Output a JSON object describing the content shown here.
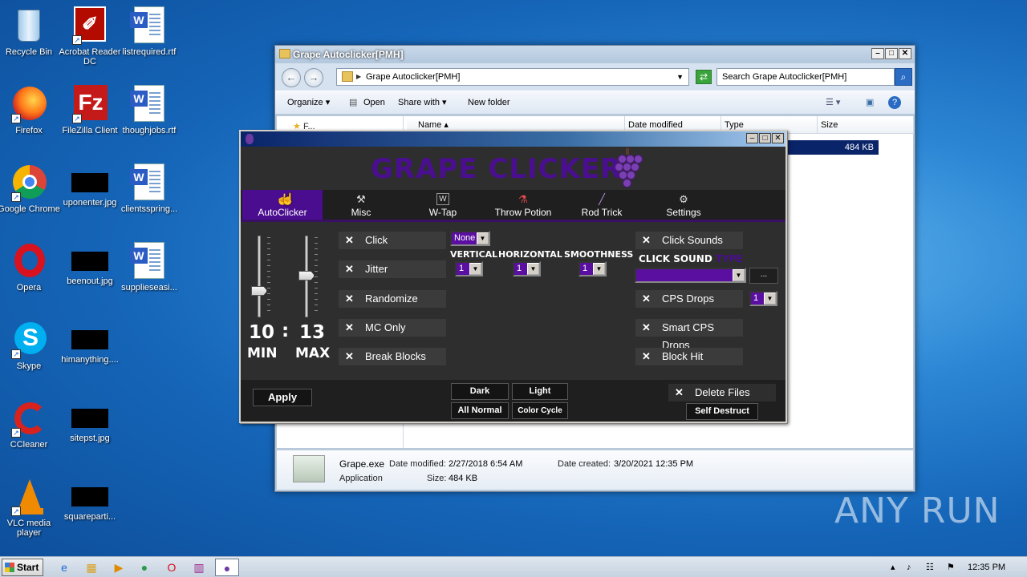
{
  "desktop": {
    "icons": [
      {
        "label": "Recycle Bin",
        "icon": "recycle-bin-icon"
      },
      {
        "label": "Acrobat Reader DC",
        "icon": "acrobat-icon"
      },
      {
        "label": "listrequired.rtf",
        "icon": "word-doc-icon"
      },
      {
        "label": "Firefox",
        "icon": "firefox-icon"
      },
      {
        "label": "FileZilla Client",
        "icon": "filezilla-icon"
      },
      {
        "label": "thoughjobs.rtf",
        "icon": "word-doc-icon"
      },
      {
        "label": "Google Chrome",
        "icon": "chrome-icon"
      },
      {
        "label": "uponenter.jpg",
        "icon": "image-thumb-icon"
      },
      {
        "label": "clientsspring...",
        "icon": "word-doc-icon"
      },
      {
        "label": "Opera",
        "icon": "opera-icon"
      },
      {
        "label": "beenout.jpg",
        "icon": "image-thumb-icon"
      },
      {
        "label": "supplieseasi...",
        "icon": "word-doc-icon"
      },
      {
        "label": "Skype",
        "icon": "skype-icon"
      },
      {
        "label": "himanything....",
        "icon": "image-thumb-icon"
      },
      {
        "label": "CCleaner",
        "icon": "ccleaner-icon"
      },
      {
        "label": "sitepst.jpg",
        "icon": "image-thumb-icon"
      },
      {
        "label": "VLC media player",
        "icon": "vlc-icon"
      },
      {
        "label": "squareparti...",
        "icon": "image-thumb-icon"
      }
    ]
  },
  "explorer": {
    "title": "Grape Autoclicker[PMH]",
    "address": "Grape Autoclicker[PMH]",
    "search_placeholder": "Search Grape Autoclicker[PMH]",
    "toolbar": {
      "organize": "Organize",
      "open": "Open",
      "share_with": "Share with",
      "new_folder": "New folder"
    },
    "columns": {
      "name": "Name",
      "date_modified": "Date modified",
      "type": "Type",
      "size": "Size"
    },
    "selected_size": "484 KB",
    "nav_partial": "F...",
    "details": {
      "filename": "Grape.exe",
      "date_modified_label": "Date modified:",
      "date_modified": "2/27/2018 6:54 AM",
      "date_created_label": "Date created:",
      "date_created": "3/20/2021 12:35 PM",
      "type": "Application",
      "size_label": "Size:",
      "size": "484 KB"
    }
  },
  "grape": {
    "logo": "GRAPE CLICKER",
    "tabs": [
      {
        "label": "AutoClicker",
        "icon": "cursor-icon"
      },
      {
        "label": "Misc",
        "icon": "wrench-icon"
      },
      {
        "label": "W-Tap",
        "icon": "w-key-icon"
      },
      {
        "label": "Throw Potion",
        "icon": "potion-icon"
      },
      {
        "label": "Rod Trick",
        "icon": "fishing-rod-icon"
      },
      {
        "label": "Settings",
        "icon": "gear-icon"
      }
    ],
    "cps": {
      "min": "10",
      "separator": ":",
      "max": "13",
      "min_label": "MIN",
      "max_label": "MAX"
    },
    "left_options": [
      "Click",
      "Jitter",
      "Randomize",
      "MC Only",
      "Break Blocks"
    ],
    "option_mark": "✕",
    "mode_select": "None",
    "jitter_labels": {
      "vertical": "VERTICAL",
      "horizontal": "HORIZONTAL",
      "smoothness": "SMOOTHNESS"
    },
    "jitter_values": {
      "vertical": "1",
      "horizontal": "1",
      "smoothness": "1"
    },
    "right_options": {
      "click_sounds": "Click Sounds",
      "cps_drops": "CPS Drops",
      "smart_cps_drops": "Smart CPS Drops",
      "block_hit": "Block Hit"
    },
    "click_sound_type": {
      "part1": "CLICK SOUND",
      "part2": "TYPE"
    },
    "browse_label": "...",
    "cps_drops_value": "1",
    "apply": "Apply",
    "theme": {
      "dark": "Dark",
      "light": "Light",
      "all_normal": "All Normal",
      "color_cycle": "Color Cycle"
    },
    "delete_files": "Delete Files",
    "self_destruct": "Self Destruct"
  },
  "taskbar": {
    "start": "Start",
    "clock": "12:35 PM"
  },
  "watermark": "ANY RUN",
  "colors": {
    "accent_purple": "#4a0d8f",
    "logo_purple": "#4a0f8f"
  }
}
